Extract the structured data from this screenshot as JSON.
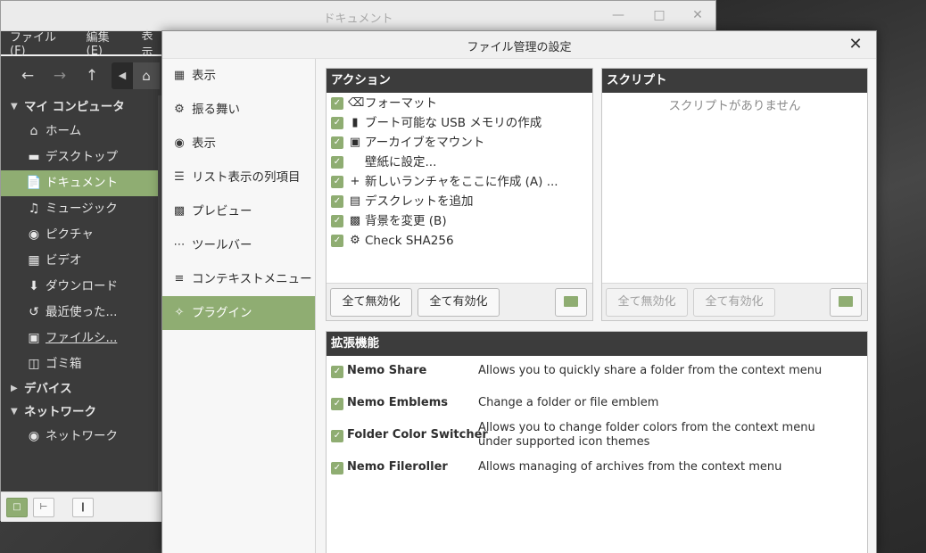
{
  "nemo": {
    "title": "ドキュメント",
    "menu": [
      "ファイル (F)",
      "編集 (E)",
      "表示"
    ],
    "sidebar": {
      "sections": [
        {
          "label": "マイ コンピュータ",
          "items": [
            {
              "label": "ホーム",
              "icon": "home-icon"
            },
            {
              "label": "デスクトップ",
              "icon": "desktop-icon"
            },
            {
              "label": "ドキュメント",
              "icon": "document-icon"
            },
            {
              "label": "ミュージック",
              "icon": "music-icon"
            },
            {
              "label": "ピクチャ",
              "icon": "camera-icon"
            },
            {
              "label": "ビデオ",
              "icon": "film-icon"
            },
            {
              "label": "ダウンロード",
              "icon": "download-icon"
            },
            {
              "label": "最近使った...",
              "icon": "history-icon"
            },
            {
              "label": "ファイルシ...",
              "icon": "drive-icon"
            },
            {
              "label": "ゴミ箱",
              "icon": "trash-icon"
            }
          ]
        },
        {
          "label": "デバイス",
          "items": []
        },
        {
          "label": "ネットワーク",
          "items": [
            {
              "label": "ネットワーク",
              "icon": "globe-icon"
            }
          ]
        }
      ]
    }
  },
  "dialog": {
    "title": "ファイル管理の設定",
    "nav": [
      {
        "label": "表示",
        "icon": "grid-icon"
      },
      {
        "label": "振る舞い",
        "icon": "gear-icon"
      },
      {
        "label": "表示",
        "icon": "eye-icon"
      },
      {
        "label": "リスト表示の列項目",
        "icon": "list-icon"
      },
      {
        "label": "プレビュー",
        "icon": "image-icon"
      },
      {
        "label": "ツールバー",
        "icon": "dots-icon"
      },
      {
        "label": "コンテキストメニュー",
        "icon": "menu-icon"
      },
      {
        "label": "プラグイン",
        "icon": "puzzle-icon"
      }
    ],
    "actions": {
      "title": "アクション",
      "items": [
        {
          "label": "フォーマット",
          "icon": "eraser-icon",
          "checked": true
        },
        {
          "label": "ブート可能な USB メモリの作成",
          "icon": "usb-icon",
          "checked": true
        },
        {
          "label": "アーカイブをマウント",
          "icon": "archive-icon",
          "checked": true
        },
        {
          "label": "壁紙に設定...",
          "icon": "",
          "checked": true
        },
        {
          "label": "新しいランチャをここに作成 (A) ...",
          "icon": "plus-icon",
          "checked": true
        },
        {
          "label": "デスクレットを追加",
          "icon": "desklet-icon",
          "checked": true
        },
        {
          "label": "背景を変更 (B)",
          "icon": "picture-icon",
          "checked": true
        },
        {
          "label": "Check SHA256",
          "icon": "cog-icon",
          "checked": true
        }
      ],
      "disable_all": "全て無効化",
      "enable_all": "全て有効化"
    },
    "scripts": {
      "title": "スクリプト",
      "empty": "スクリプトがありません",
      "disable_all": "全て無効化",
      "enable_all": "全て有効化"
    },
    "extensions": {
      "title": "拡張機能",
      "items": [
        {
          "name": "Nemo Share",
          "desc": "Allows you to quickly share a folder from the context menu",
          "checked": true
        },
        {
          "name": "Nemo Emblems",
          "desc": "Change a folder or file emblem",
          "checked": true
        },
        {
          "name": "Folder Color Switcher",
          "desc": "Allows you to change folder colors from the context menu under supported icon themes",
          "checked": true
        },
        {
          "name": "Nemo Fileroller",
          "desc": "Allows managing of archives from the context menu",
          "checked": true
        }
      ]
    }
  },
  "colors": {
    "accent": "#8fad72",
    "header": "#3c3c3c",
    "sidebar": "#3b3b3b"
  }
}
